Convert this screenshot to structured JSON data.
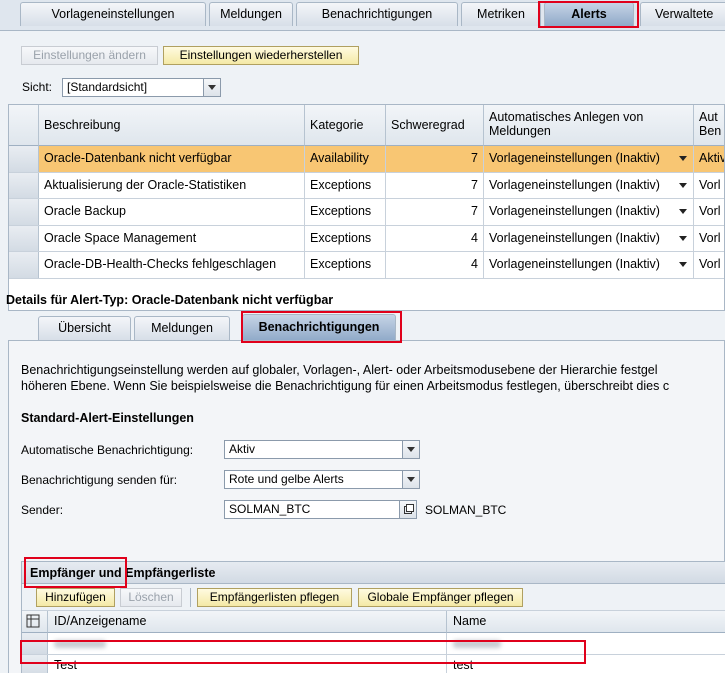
{
  "top_tabs": [
    {
      "label": "Vorlageneinstellungen"
    },
    {
      "label": "Meldungen"
    },
    {
      "label": "Benachrichtigungen"
    },
    {
      "label": "Metriken"
    },
    {
      "label": "Alerts",
      "selected": true
    },
    {
      "label": "Verwaltete"
    }
  ],
  "toolbar": {
    "change_settings": "Einstellungen ändern",
    "restore_settings": "Einstellungen wiederherstellen"
  },
  "view": {
    "label": "Sicht:",
    "value": "[Standardsicht]"
  },
  "alert_table": {
    "headers": {
      "description": "Beschreibung",
      "category": "Kategorie",
      "severity": "Schweregrad",
      "auto_create_line1": "Automatisches Anlegen von",
      "auto_create_line2": "Meldungen",
      "auto_notify_line1": "Aut",
      "auto_notify_line2": "Ben"
    },
    "rows": [
      {
        "description": "Oracle-Datenbank nicht verfügbar",
        "category": "Availability",
        "severity": "7",
        "auto_create": "Vorlageneinstellungen (Inaktiv)",
        "auto_notify": "Aktiv"
      },
      {
        "description": "Aktualisierung der Oracle-Statistiken",
        "category": "Exceptions",
        "severity": "7",
        "auto_create": "Vorlageneinstellungen (Inaktiv)",
        "auto_notify": "Vorl"
      },
      {
        "description": "Oracle Backup",
        "category": "Exceptions",
        "severity": "7",
        "auto_create": "Vorlageneinstellungen (Inaktiv)",
        "auto_notify": "Vorl"
      },
      {
        "description": "Oracle Space Management",
        "category": "Exceptions",
        "severity": "4",
        "auto_create": "Vorlageneinstellungen (Inaktiv)",
        "auto_notify": "Vorl"
      },
      {
        "description": "Oracle-DB-Health-Checks fehlgeschlagen",
        "category": "Exceptions",
        "severity": "4",
        "auto_create": "Vorlageneinstellungen (Inaktiv)",
        "auto_notify": "Vorl"
      }
    ]
  },
  "details": {
    "title": "Details für Alert-Typ: Oracle-Datenbank nicht verfügbar",
    "tabs": [
      {
        "label": "Übersicht"
      },
      {
        "label": "Meldungen"
      },
      {
        "label": "Benachrichtigungen",
        "selected": true
      }
    ],
    "info_line1": "Benachrichtigungseinstellung werden auf globaler, Vorlagen-, Alert- oder Arbeitsmodusebene der Hierarchie festgel",
    "info_line2": "höheren Ebene. Wenn Sie beispielsweise die Benachrichtigung für einen Arbeitsmodus festlegen, überschreibt dies c",
    "section_title": "Standard-Alert-Einstellungen",
    "auto_notification_label": "Automatische Benachrichtigung:",
    "auto_notification_value": "Aktiv",
    "send_for_label": "Benachrichtigung senden für:",
    "send_for_value": "Rote und gelbe Alerts",
    "sender_label": "Sender:",
    "sender_value": "SOLMAN_BTC",
    "sender_text": "SOLMAN_BTC"
  },
  "recipients": {
    "title": "Empfänger und Empfängerliste",
    "add_button": "Hinzufügen",
    "delete_button": "Löschen",
    "maintain_lists_button": "Empfängerlisten pflegen",
    "global_recipients_button": "Globale Empfänger pflegen",
    "col_id": "ID/Anzeigename",
    "col_name": "Name",
    "rows": [
      {
        "id": "",
        "name": ""
      },
      {
        "id": "Test",
        "name": "test"
      }
    ]
  },
  "colors": {
    "highlight": "#e0001b",
    "selected_row": "#f8c673",
    "button_yellow": "#f4e9a6"
  }
}
